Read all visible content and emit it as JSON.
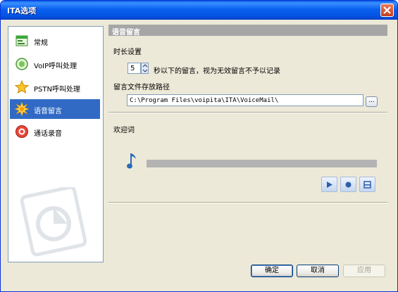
{
  "window": {
    "title": "ITA选项"
  },
  "nav": {
    "items": [
      {
        "label": "常规",
        "icon": "general-settings-icon"
      },
      {
        "label": "VoIP呼叫处理",
        "icon": "voip-call-icon"
      },
      {
        "label": "PSTN呼叫处理",
        "icon": "pstn-star-icon"
      },
      {
        "label": "语音留言",
        "icon": "voicemail-burst-icon",
        "selected": true
      },
      {
        "label": "通话录音",
        "icon": "call-record-icon"
      }
    ]
  },
  "panel": {
    "header": "语音留言",
    "duration_section": "时长设置",
    "duration_value": "5",
    "duration_hint": "秒以下的留言，视为无效留言不予以记录",
    "path_section": "留言文件存放路径",
    "path_value": "C:\\Program Files\\voipita\\ITA\\VoiceMail\\",
    "browse_label": "...",
    "welcome_section": "欢迎词",
    "music_icon": "music-note-icon"
  },
  "buttons": {
    "ok": "确定",
    "cancel": "取消",
    "apply": "应用"
  },
  "colors": {
    "titlebar": "#0a5de7",
    "selected_nav": "#316ac5",
    "panel_header": "#a6a6a6",
    "dialog_bg": "#ece9d8"
  }
}
